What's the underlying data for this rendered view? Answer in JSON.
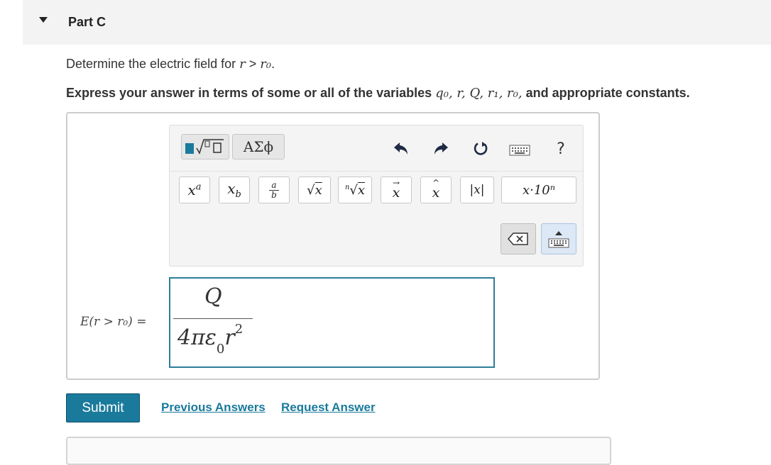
{
  "part": {
    "title": "Part C"
  },
  "question": {
    "prompt_text": "Determine the electric field for",
    "prompt_var": "r",
    "prompt_op": " > ",
    "prompt_var2": "r₀",
    "prompt_end": "."
  },
  "instruction": {
    "text": "Express your answer in terms of some or all of the variables",
    "vars": "q₀, r, Q, r₁, r₀,",
    "tail": "and appropriate constants."
  },
  "toolbar": {
    "greek_label": "ΑΣϕ",
    "help_label": "?",
    "math_buttons": {
      "superscript": "xᵃ",
      "subscript": "x_b",
      "fraction_top": "a",
      "fraction_bottom": "b",
      "sqrt": "√x",
      "nth_root_index": "n",
      "nth_root": "√x",
      "vector": "x",
      "unit_vector": "x",
      "abs": "|x|",
      "sci_notation": "x·10ⁿ"
    }
  },
  "answer": {
    "label_lhs": "E(r > r₀) =",
    "numerator": "Q",
    "denom_prefix": "4πε",
    "denom_sub": "0",
    "denom_var": "r",
    "denom_exp": "2"
  },
  "actions": {
    "submit_label": "Submit",
    "previous_answers": "Previous Answers",
    "request_answer": "Request Answer"
  },
  "colors": {
    "accent": "#1a7a9c",
    "input_border": "#2e7d9a",
    "header_bg": "#f3f3f3"
  }
}
